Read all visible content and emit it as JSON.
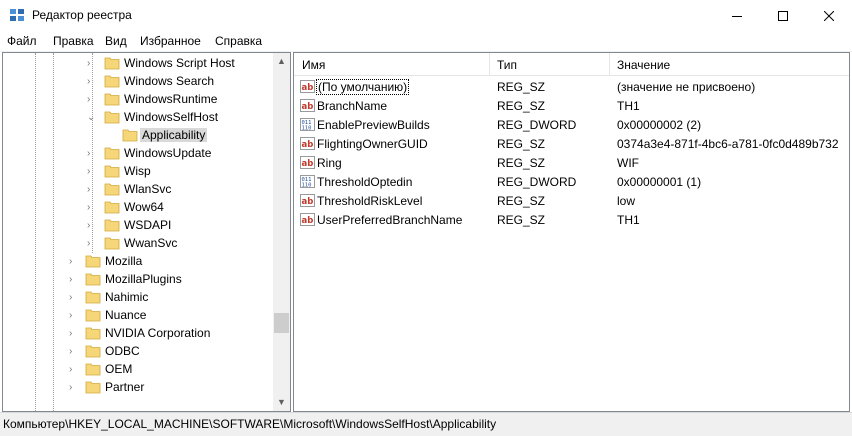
{
  "window": {
    "title": "Редактор реестра"
  },
  "menu": [
    "Файл",
    "Правка",
    "Вид",
    "Избранное",
    "Справка"
  ],
  "tree": {
    "items": [
      {
        "label": "Windows Script Host",
        "level": 2,
        "expanded": false,
        "selected": false
      },
      {
        "label": "Windows Search",
        "level": 2,
        "expanded": false,
        "selected": false
      },
      {
        "label": "WindowsRuntime",
        "level": 2,
        "expanded": false,
        "selected": false
      },
      {
        "label": "WindowsSelfHost",
        "level": 2,
        "expanded": true,
        "selected": false
      },
      {
        "label": "Applicability",
        "level": 3,
        "expanded": null,
        "selected": true
      },
      {
        "label": "WindowsUpdate",
        "level": 2,
        "expanded": false,
        "selected": false
      },
      {
        "label": "Wisp",
        "level": 2,
        "expanded": false,
        "selected": false
      },
      {
        "label": "WlanSvc",
        "level": 2,
        "expanded": false,
        "selected": false
      },
      {
        "label": "Wow64",
        "level": 2,
        "expanded": false,
        "selected": false
      },
      {
        "label": "WSDAPI",
        "level": 2,
        "expanded": false,
        "selected": false
      },
      {
        "label": "WwanSvc",
        "level": 2,
        "expanded": false,
        "selected": false
      },
      {
        "label": "Mozilla",
        "level": 1,
        "expanded": false,
        "selected": false
      },
      {
        "label": "MozillaPlugins",
        "level": 1,
        "expanded": false,
        "selected": false
      },
      {
        "label": "Nahimic",
        "level": 1,
        "expanded": false,
        "selected": false
      },
      {
        "label": "Nuance",
        "level": 1,
        "expanded": false,
        "selected": false
      },
      {
        "label": "NVIDIA Corporation",
        "level": 1,
        "expanded": false,
        "selected": false
      },
      {
        "label": "ODBC",
        "level": 1,
        "expanded": false,
        "selected": false
      },
      {
        "label": "OEM",
        "level": 1,
        "expanded": false,
        "selected": false
      },
      {
        "label": "Partner",
        "level": 1,
        "expanded": false,
        "selected": false
      }
    ],
    "scroll_position": 0.8
  },
  "list": {
    "columns": [
      "Имя",
      "Тип",
      "Значение"
    ],
    "rows": [
      {
        "icon": "string-value-icon",
        "name": "(По умолчанию)",
        "type": "REG_SZ",
        "value": "(значение не присвоено)"
      },
      {
        "icon": "string-value-icon",
        "name": "BranchName",
        "type": "REG_SZ",
        "value": "TH1"
      },
      {
        "icon": "binary-value-icon",
        "name": "EnablePreviewBuilds",
        "type": "REG_DWORD",
        "value": "0x00000002 (2)"
      },
      {
        "icon": "string-value-icon",
        "name": "FlightingOwnerGUID",
        "type": "REG_SZ",
        "value": "0374a3e4-871f-4bc6-a781-0fc0d489b732"
      },
      {
        "icon": "string-value-icon",
        "name": "Ring",
        "type": "REG_SZ",
        "value": "WIF"
      },
      {
        "icon": "binary-value-icon",
        "name": "ThresholdOptedin",
        "type": "REG_DWORD",
        "value": "0x00000001 (1)"
      },
      {
        "icon": "string-value-icon",
        "name": "ThresholdRiskLevel",
        "type": "REG_SZ",
        "value": "low"
      },
      {
        "icon": "string-value-icon",
        "name": "UserPreferredBranchName",
        "type": "REG_SZ",
        "value": "TH1"
      }
    ]
  },
  "status": {
    "path": "Компьютер\\HKEY_LOCAL_MACHINE\\SOFTWARE\\Microsoft\\WindowsSelfHost\\Applicability"
  },
  "colors": {
    "folder": "#f5d77a",
    "selection": "#d9d9d9",
    "string_icon": "#c0392b",
    "binary_icon": "#1f4e9e"
  }
}
